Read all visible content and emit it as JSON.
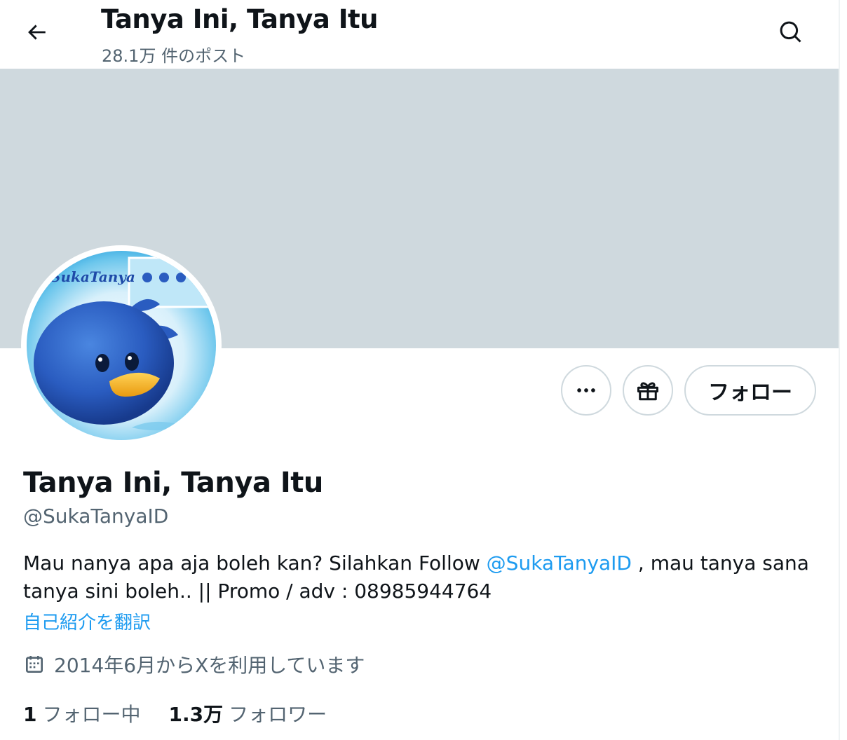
{
  "header": {
    "title": "Tanya Ini, Tanya Itu",
    "post_count": "28.1万 件のポスト",
    "back_icon": "arrow-left-icon",
    "search_icon": "search-icon"
  },
  "colors": {
    "banner": "#cfd9de",
    "link": "#1d9bf0",
    "secondary_text": "#536471",
    "primary_text": "#0f1419"
  },
  "actions": {
    "more_icon": "more-horizontal-icon",
    "gift_icon": "gift-icon",
    "follow_label": "フォロー"
  },
  "profile": {
    "display_name": "Tanya Ini, Tanya Itu",
    "handle": "@SukaTanyaID",
    "avatar_text": "SukaTanya",
    "bio_part1": "Mau nanya apa aja boleh kan? Silahkan Follow ",
    "bio_mention": "@SukaTanyaID",
    "bio_part2": " , mau tanya sana tanya sini boleh.. || Promo / adv : 08985944764",
    "translate_label": "自己紹介を翻訳",
    "joined": "2014年6月からXを利用しています",
    "following_count": "1",
    "following_label": "フォロー中",
    "followers_count": "1.3万",
    "followers_label": "フォロワー"
  }
}
